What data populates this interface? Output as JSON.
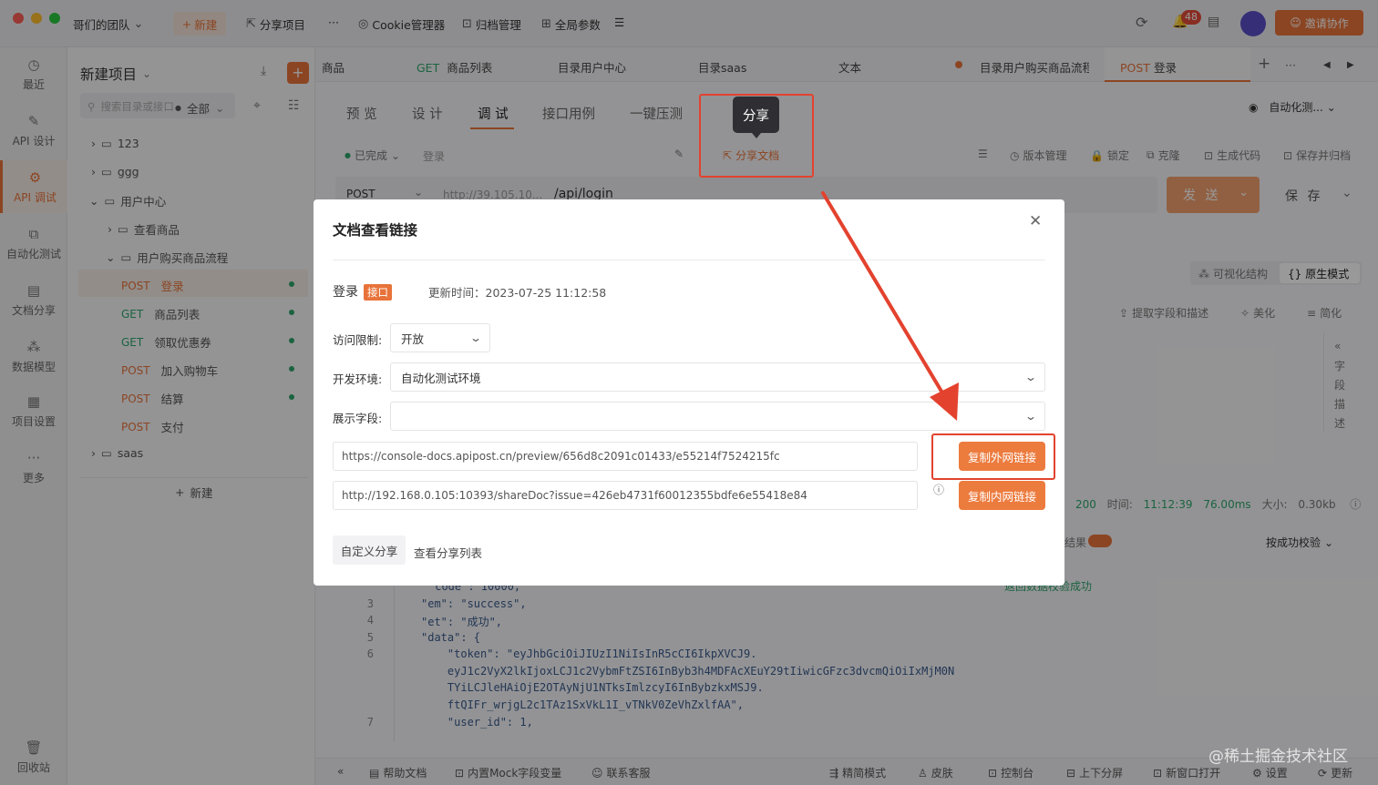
{
  "titlebar": {
    "team": "哥们的团队",
    "new_btn": "新建",
    "share_project": "分享项目",
    "more": "···",
    "cookie_manager": "Cookie管理器",
    "archive": "归档管理",
    "global_params": "全局参数",
    "notification_count": "48",
    "invite": "邀请协作"
  },
  "leftnav": {
    "items": [
      "最近",
      "API 设计",
      "API 调试",
      "自动化测试",
      "文档分享",
      "数据模型",
      "项目设置",
      "更多"
    ],
    "trash": "回收站"
  },
  "tree": {
    "project": "新建项目",
    "search_placeholder": "搜索目录或接口",
    "filter": "全部",
    "folders": {
      "f1": "123",
      "f2": "ggg",
      "f3": "用户中心",
      "f4": "查看商品",
      "f5": "用户购买商品流程",
      "f6": "saas"
    },
    "apis": [
      {
        "method": "POST",
        "name": "登录"
      },
      {
        "method": "GET",
        "name": "商品列表"
      },
      {
        "method": "GET",
        "name": "领取优惠券"
      },
      {
        "method": "POST",
        "name": "加入购物车"
      },
      {
        "method": "POST",
        "name": "结算"
      },
      {
        "method": "POST",
        "name": "支付"
      }
    ],
    "new_label": "新建"
  },
  "tabs": {
    "t1": "商品",
    "t2_method": "GET",
    "t2": "商品列表",
    "t3": "目录用户中心",
    "t4": "目录saas",
    "t5": "文本",
    "t6": "目录用户购买商品流程",
    "t7_method": "POST",
    "t7": "登录"
  },
  "subtabs": [
    "预 览",
    "设 计",
    "调 试",
    "接口用例",
    "一键压测"
  ],
  "toolbar": {
    "status": "已完成",
    "name": "登录",
    "share_doc": "分享文档",
    "version": "版本管理",
    "lock": "锁定",
    "clone": "克隆",
    "gen_code": "生成代码",
    "save_archive": "保存并归档",
    "auto_test": "自动化测...",
    "tooltip": "分享"
  },
  "request": {
    "method": "POST",
    "host": "http://39.105.10...",
    "path": "/api/login",
    "send": "发 送",
    "save": "保 存"
  },
  "response": {
    "visual": "可视化结构",
    "raw": "原生模式",
    "extract": "提取字段和描述",
    "beautify": "美化",
    "simplify": "简化",
    "side_tab": [
      "字",
      "段",
      "描",
      "述"
    ],
    "status_code": "200",
    "time_label": "时间:",
    "time": "11:12:39",
    "duration": "76.00ms",
    "size_label": "大小:",
    "size": "0.30kb",
    "result": "结果",
    "verify_mode": "按成功校验",
    "verify_ok": "返回数据校验成功"
  },
  "code": {
    "line_numbers": [
      "3",
      "4",
      "5",
      "6",
      "7"
    ],
    "lines": [
      "\"code\": 10000,",
      "\"em\": \"success\",",
      "\"et\": \"成功\",",
      "\"data\": {",
      "    \"token\": \"eyJhbGciOiJIUzI1NiIsInR5cCI6IkpXVCJ9.",
      "    eyJ1c2VyX2lkIjoxLCJ1c2VybmFtZSI6InByb3h4MDFAcXEuY29tIiwicGFzc3dvcmQiOiIxMjM0N",
      "    TYiLCJleHAiOjE2OTAyNjU1NTksImlzcyI6InBybzkxMSJ9.",
      "    ftQIFr_wrjgL2c1TAz1SxVkL1I_vTNkV0ZeVhZxlfAA\",",
      "    \"user_id\": 1,"
    ]
  },
  "bottombar": {
    "help": "帮助文档",
    "mock": "内置Mock字段变量",
    "support": "联系客服",
    "lean": "精简模式",
    "skin": "皮肤",
    "console": "控制台",
    "split": "上下分屏",
    "new_window": "新窗口打开",
    "settings": "设置",
    "update": "更新"
  },
  "watermark": "@稀土掘金技术社区",
  "modal": {
    "title": "文档查看链接",
    "api_name": "登录",
    "api_tag": "接口",
    "updated": "更新时间：2023-07-25 11:12:58",
    "access_label": "访问限制:",
    "access_value": "开放",
    "env_label": "开发环境:",
    "env_value": "自动化测试环境",
    "fields_label": "展示字段:",
    "fields_value": "",
    "external_url": "https://console-docs.apipost.cn/preview/656d8c2091c01433/e55214f7524215fc",
    "internal_url": "http://192.168.0.105:10393/shareDoc?issue=426eb4731f60012355bdfe6e55418e84",
    "copy_external": "复制外网链接",
    "copy_internal": "复制内网链接",
    "custom_share": "自定义分享",
    "share_list": "查看分享列表"
  },
  "colors": {
    "accent": "#e8733a",
    "annotation_red": "#e3422f",
    "get_green": "#2ea66c"
  }
}
